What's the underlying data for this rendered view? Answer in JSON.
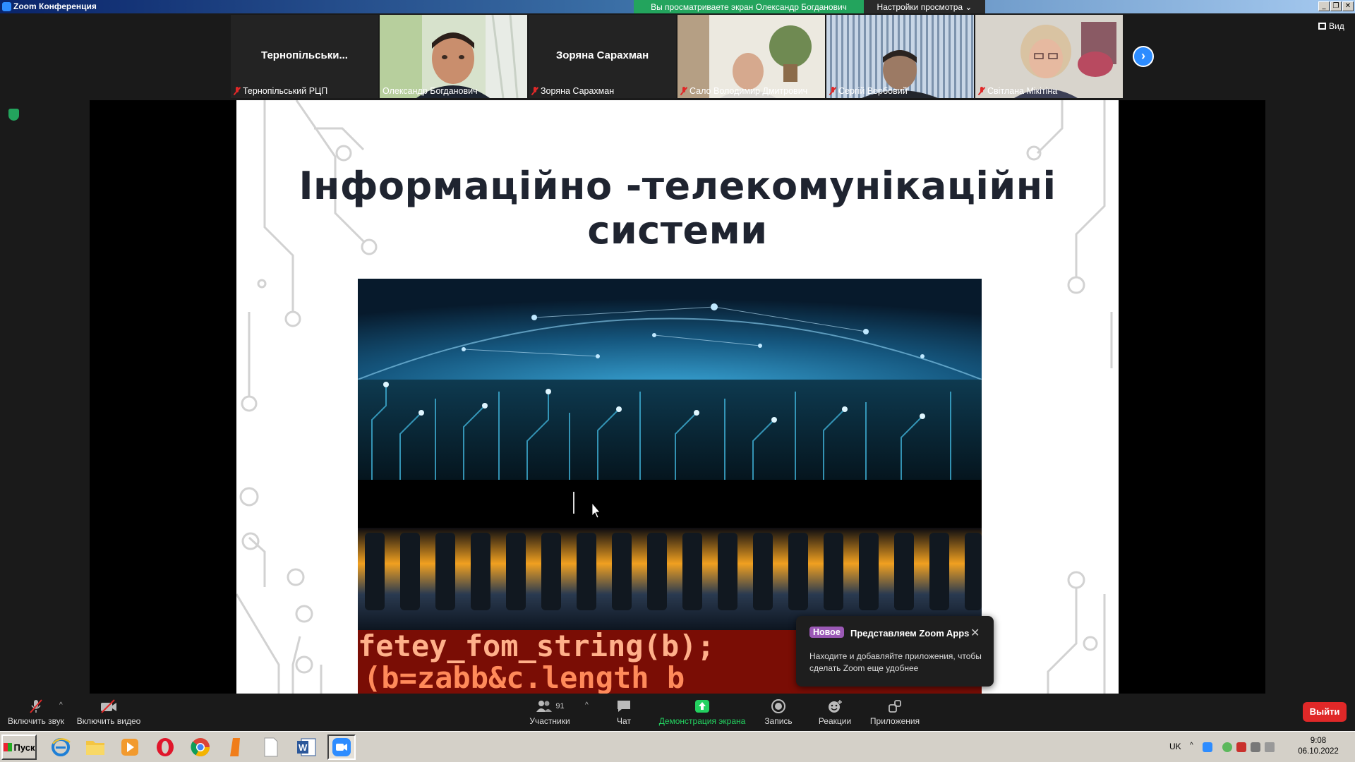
{
  "window": {
    "title": "Zoom Конференция",
    "share_banner": "Вы просматриваете экран Олександр Богданович",
    "view_options": "Настройки просмотра ⌄",
    "view_label": "Вид",
    "controls": [
      "_",
      "❐",
      "✕"
    ]
  },
  "participants": [
    {
      "center_name": "Тернопільськи...",
      "label": "Тернопільський РЦП",
      "has_video": false,
      "muted": true
    },
    {
      "center_name": "",
      "label": "Олександр Богданович",
      "has_video": true,
      "muted": false,
      "active_speaker": true
    },
    {
      "center_name": "Зоряна Сарахман",
      "label": "Зоряна Сарахман",
      "has_video": false,
      "muted": true
    },
    {
      "center_name": "",
      "label": "Сало Володимир Дмитрович",
      "has_video": true,
      "muted": true
    },
    {
      "center_name": "",
      "label": "Сергій Вербовий",
      "has_video": true,
      "muted": true
    },
    {
      "center_name": "",
      "label": "Світлана Мікітіна",
      "has_video": true,
      "muted": true
    }
  ],
  "slide": {
    "title": "Інформаційно -телекомунікаційні системи",
    "code_text": "fetey_fom_string(b);",
    "code_text2": "(b=zabb&c.length b"
  },
  "popup": {
    "badge": "Новое",
    "heading": "Представляем Zoom Apps",
    "body": "Находите и добавляйте приложения, чтобы сделать Zoom еще удобнее"
  },
  "toolbar": {
    "audio": "Включить звук",
    "video": "Включить видео",
    "participants": "Участники",
    "participant_count": "91",
    "chat": "Чат",
    "share": "Демонстрация экрана",
    "record": "Запись",
    "reactions": "Реакции",
    "apps": "Приложения",
    "leave": "Выйти"
  },
  "taskbar": {
    "start": "Пуск",
    "lang": "UK",
    "time": "9:08",
    "date": "06.10.2022"
  },
  "colors": {
    "accent": "#2d8cff",
    "share_green": "#23a45d",
    "leave_red": "#e02828"
  }
}
